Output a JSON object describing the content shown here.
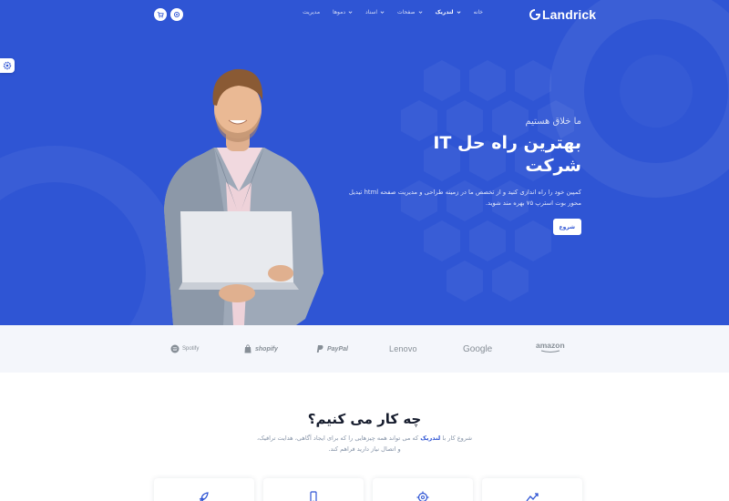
{
  "brand": {
    "name": "Landrick"
  },
  "nav": {
    "items": [
      {
        "label": "خانه",
        "has_dropdown": false,
        "active": false
      },
      {
        "label": "لندریک",
        "has_dropdown": true,
        "active": true
      },
      {
        "label": "صفحات",
        "has_dropdown": true,
        "active": false
      },
      {
        "label": "اسناد",
        "has_dropdown": true,
        "active": false
      },
      {
        "label": "دموها",
        "has_dropdown": true,
        "active": false
      },
      {
        "label": "مدیریت",
        "has_dropdown": false,
        "active": false
      }
    ],
    "buttons": [
      {
        "icon": "settings-icon"
      },
      {
        "icon": "shopping-cart-icon"
      }
    ]
  },
  "side_settings": {
    "icon": "gear-icon"
  },
  "hero": {
    "kicker": "ما خلاق هستیم",
    "title_line1": "بهترین راه حل IT",
    "title_line2": "شرکت",
    "description": "کمپین خود را راه اندازی کنید و از تخصص ما در زمینه طراحی و مدیریت صفحه html تیدیل محور بوت استرپ ۷۵ بهره مند شوید.",
    "cta_label": "شروع",
    "image": "businessman-with-laptop"
  },
  "partners": [
    {
      "name": "Spotify",
      "icon": "spotify-icon"
    },
    {
      "name": "shopify",
      "icon": "shopify-bag-icon"
    },
    {
      "name": "PayPal",
      "icon": "paypal-icon"
    },
    {
      "name": "Lenovo",
      "icon": ""
    },
    {
      "name": "Google",
      "icon": ""
    },
    {
      "name": "amazon",
      "icon": "amazon-smile-icon"
    }
  ],
  "services": {
    "title": "چه کار می کنیم؟",
    "description_pre": "شروع کار با",
    "description_brand": "لندریک",
    "description_post": "که می تواند همه چیزهایی را که برای ایجاد آگاهی، هدایت ترافیک، و اتصال نیاز دارید فراهم کند.",
    "cards": [
      {
        "icon": "rocket-icon"
      },
      {
        "icon": "smartphone-icon"
      },
      {
        "icon": "crosshair-icon"
      },
      {
        "icon": "trending-up-icon"
      }
    ]
  },
  "colors": {
    "primary": "#2f55d4",
    "heading": "#161c2d",
    "muted": "#8492a6",
    "brand_gray": "#868e96",
    "light_bg": "#f4f6fb"
  }
}
